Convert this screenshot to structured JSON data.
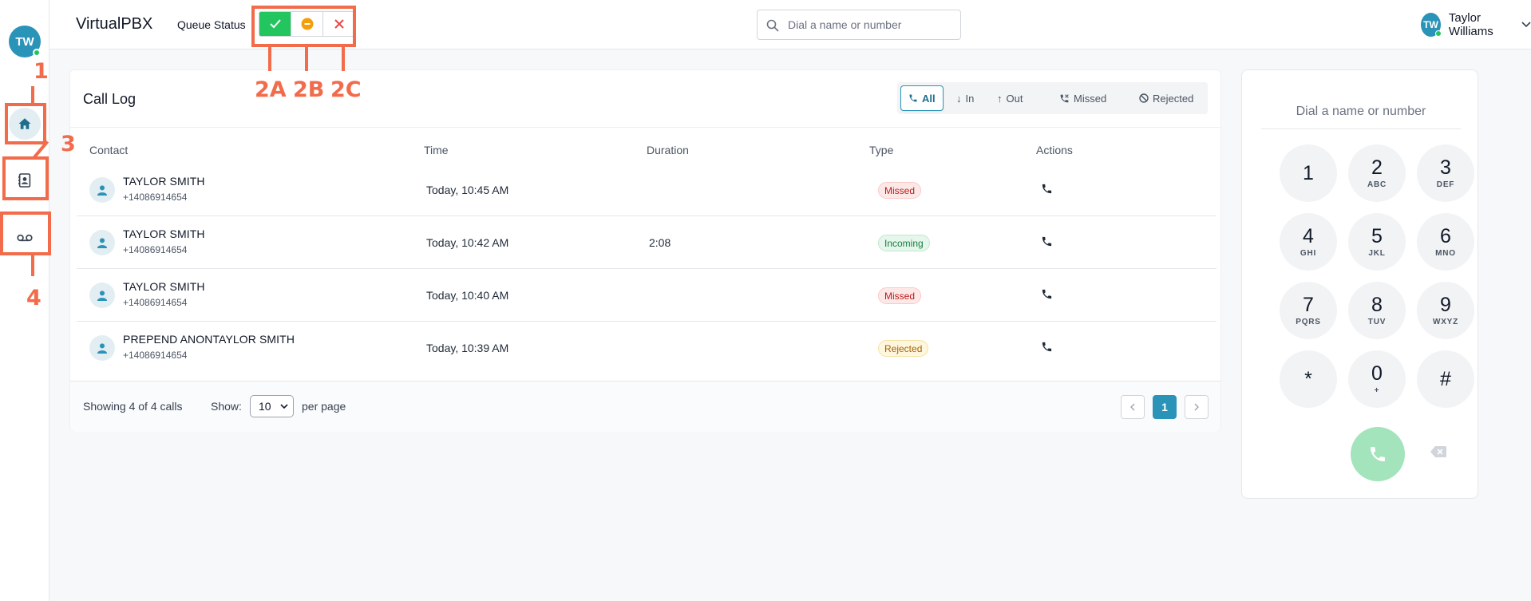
{
  "user": {
    "initials": "TW",
    "name": "Taylor Williams"
  },
  "header": {
    "brand": "VirtualPBX",
    "queue_status_label": "Queue Status",
    "search_placeholder": "Dial a name or number"
  },
  "annotations": {
    "a1": "1",
    "a2a": "2A",
    "a2b": "2B",
    "a2c": "2C",
    "a3": "3",
    "a4": "4"
  },
  "call_log": {
    "title": "Call Log",
    "filters": [
      "All",
      "In",
      "Out",
      "Missed",
      "Rejected"
    ],
    "columns": [
      "Contact",
      "Time",
      "Duration",
      "Type",
      "Actions"
    ],
    "rows": [
      {
        "name": "TAYLOR SMITH",
        "number": "+14086914654",
        "time": "Today, 10:45 AM",
        "duration": "",
        "type": "Missed"
      },
      {
        "name": "TAYLOR SMITH",
        "number": "+14086914654",
        "time": "Today, 10:42 AM",
        "duration": "2:08",
        "type": "Incoming"
      },
      {
        "name": "TAYLOR SMITH",
        "number": "+14086914654",
        "time": "Today, 10:40 AM",
        "duration": "",
        "type": "Missed"
      },
      {
        "name": "PREPEND ANONTAYLOR SMITH",
        "number": "+14086914654",
        "time": "Today, 10:39 AM",
        "duration": "",
        "type": "Rejected"
      }
    ],
    "footer": {
      "showing": "Showing 4 of 4 calls",
      "show_label": "Show:",
      "per_page_value": "10",
      "per_page_label": "per page",
      "current_page": "1"
    }
  },
  "dialer": {
    "placeholder": "Dial a name or number",
    "keys": [
      {
        "digit": "1",
        "letters": ""
      },
      {
        "digit": "2",
        "letters": "ABC"
      },
      {
        "digit": "3",
        "letters": "DEF"
      },
      {
        "digit": "4",
        "letters": "GHI"
      },
      {
        "digit": "5",
        "letters": "JKL"
      },
      {
        "digit": "6",
        "letters": "MNO"
      },
      {
        "digit": "7",
        "letters": "PQRS"
      },
      {
        "digit": "8",
        "letters": "TUV"
      },
      {
        "digit": "9",
        "letters": "WXYZ"
      },
      {
        "digit": "*",
        "letters": ""
      },
      {
        "digit": "0",
        "letters": "+"
      },
      {
        "digit": "#",
        "letters": ""
      }
    ]
  },
  "colors": {
    "accent": "#2a93b8",
    "annotation": "#f26b4a",
    "available": "#22c55e",
    "away": "#f59e0b",
    "offline": "#ef4444"
  }
}
